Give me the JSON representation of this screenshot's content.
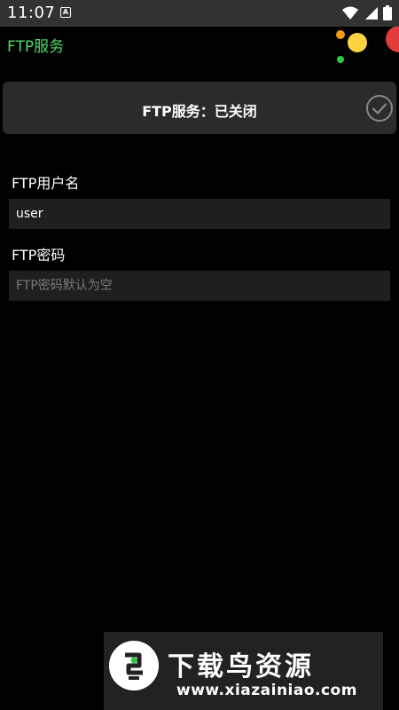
{
  "status_bar": {
    "time": "11:07",
    "notification_badge": "A",
    "icons": [
      "wifi-icon",
      "cellular-signal-icon",
      "battery-icon"
    ]
  },
  "app": {
    "title": "FTP服务",
    "accent_color": "#4cd964"
  },
  "service": {
    "status_label": "FTP服务：已关闭",
    "toggle_icon": "checkmark-circle-icon"
  },
  "form": {
    "username_label": "FTP用户名",
    "username_value": "user",
    "password_label": "FTP密码",
    "password_value": "",
    "password_placeholder": "FTP密码默认为空"
  },
  "watermark": {
    "title": "下载鸟资源",
    "url": "www.xiazainiao.com"
  }
}
